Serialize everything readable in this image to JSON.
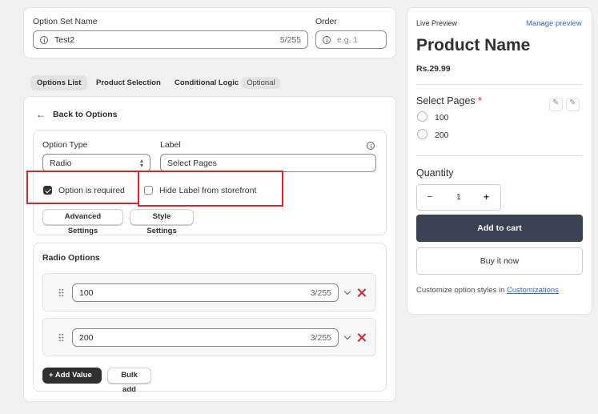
{
  "option_set": {
    "name_label": "Option Set Name",
    "name_value": "Test2",
    "name_counter": "5/255",
    "order_label": "Order",
    "order_placeholder": "e.g. 1"
  },
  "tabs": [
    {
      "label": "Options List"
    },
    {
      "label": "Product Selection"
    },
    {
      "label": "Conditional Logic",
      "badge": "Optional"
    }
  ],
  "editor": {
    "back_label": "Back to Options",
    "option_type_label": "Option Type",
    "option_type_value": "Radio",
    "label_label": "Label",
    "label_value": "Select Pages",
    "required_label": "Option is required",
    "hide_label": "Hide Label from storefront",
    "advanced_btn": "Advanced Settings",
    "style_btn": "Style Settings"
  },
  "radio_options": {
    "title": "Radio Options",
    "values": [
      {
        "value": "100",
        "counter": "3/255"
      },
      {
        "value": "200",
        "counter": "3/255"
      }
    ],
    "add_value": "+ Add Value",
    "bulk_add": "Bulk add"
  },
  "preview": {
    "live_label": "Live Preview",
    "manage_link": "Manage preview",
    "product_name": "Product Name",
    "price": "Rs.29.99",
    "option_title": "Select Pages",
    "required_mark": "*",
    "options": [
      "100",
      "200"
    ],
    "quantity_label": "Quantity",
    "qty_minus": "−",
    "qty_value": "1",
    "qty_plus": "+",
    "add_to_cart": "Add to cart",
    "buy_now": "Buy it now",
    "customize_text": "Customize option styles in ",
    "customize_link": "Customizations"
  },
  "colors": {
    "primary_dark": "#303030",
    "cart_button": "#3b4252",
    "link": "#2c6ecb",
    "highlight_red": "#d9262c",
    "delete_red": "#c8262c"
  }
}
